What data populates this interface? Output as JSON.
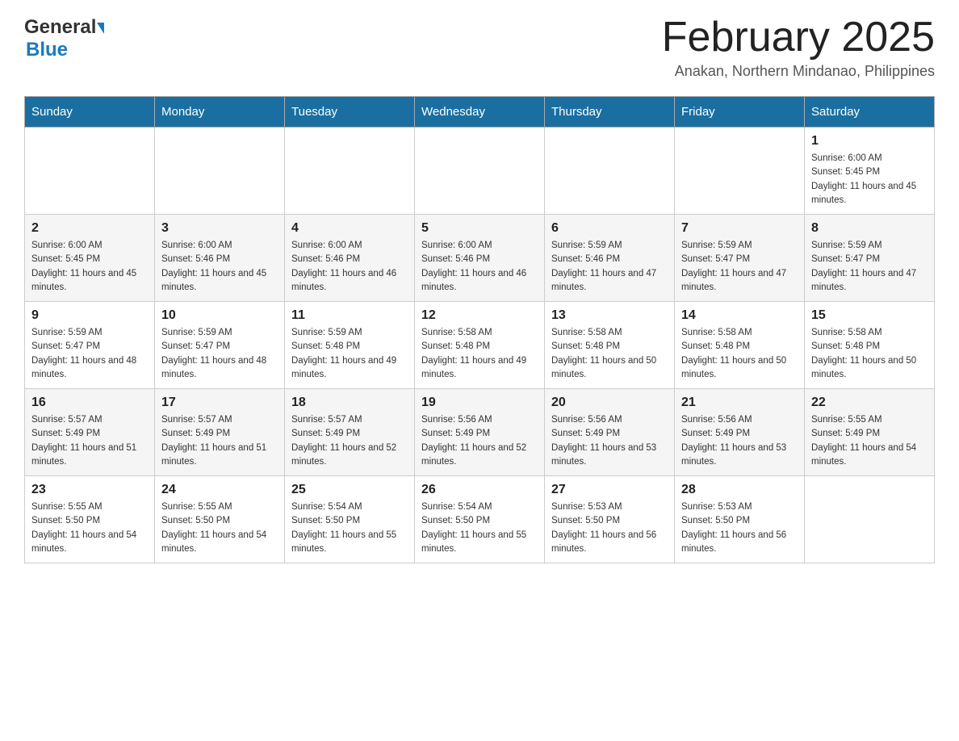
{
  "header": {
    "logo_general": "General",
    "logo_blue": "Blue",
    "month_title": "February 2025",
    "location": "Anakan, Northern Mindanao, Philippines"
  },
  "days_of_week": [
    "Sunday",
    "Monday",
    "Tuesday",
    "Wednesday",
    "Thursday",
    "Friday",
    "Saturday"
  ],
  "weeks": [
    [
      {
        "day": "",
        "info": ""
      },
      {
        "day": "",
        "info": ""
      },
      {
        "day": "",
        "info": ""
      },
      {
        "day": "",
        "info": ""
      },
      {
        "day": "",
        "info": ""
      },
      {
        "day": "",
        "info": ""
      },
      {
        "day": "1",
        "info": "Sunrise: 6:00 AM\nSunset: 5:45 PM\nDaylight: 11 hours and 45 minutes."
      }
    ],
    [
      {
        "day": "2",
        "info": "Sunrise: 6:00 AM\nSunset: 5:45 PM\nDaylight: 11 hours and 45 minutes."
      },
      {
        "day": "3",
        "info": "Sunrise: 6:00 AM\nSunset: 5:46 PM\nDaylight: 11 hours and 45 minutes."
      },
      {
        "day": "4",
        "info": "Sunrise: 6:00 AM\nSunset: 5:46 PM\nDaylight: 11 hours and 46 minutes."
      },
      {
        "day": "5",
        "info": "Sunrise: 6:00 AM\nSunset: 5:46 PM\nDaylight: 11 hours and 46 minutes."
      },
      {
        "day": "6",
        "info": "Sunrise: 5:59 AM\nSunset: 5:46 PM\nDaylight: 11 hours and 47 minutes."
      },
      {
        "day": "7",
        "info": "Sunrise: 5:59 AM\nSunset: 5:47 PM\nDaylight: 11 hours and 47 minutes."
      },
      {
        "day": "8",
        "info": "Sunrise: 5:59 AM\nSunset: 5:47 PM\nDaylight: 11 hours and 47 minutes."
      }
    ],
    [
      {
        "day": "9",
        "info": "Sunrise: 5:59 AM\nSunset: 5:47 PM\nDaylight: 11 hours and 48 minutes."
      },
      {
        "day": "10",
        "info": "Sunrise: 5:59 AM\nSunset: 5:47 PM\nDaylight: 11 hours and 48 minutes."
      },
      {
        "day": "11",
        "info": "Sunrise: 5:59 AM\nSunset: 5:48 PM\nDaylight: 11 hours and 49 minutes."
      },
      {
        "day": "12",
        "info": "Sunrise: 5:58 AM\nSunset: 5:48 PM\nDaylight: 11 hours and 49 minutes."
      },
      {
        "day": "13",
        "info": "Sunrise: 5:58 AM\nSunset: 5:48 PM\nDaylight: 11 hours and 50 minutes."
      },
      {
        "day": "14",
        "info": "Sunrise: 5:58 AM\nSunset: 5:48 PM\nDaylight: 11 hours and 50 minutes."
      },
      {
        "day": "15",
        "info": "Sunrise: 5:58 AM\nSunset: 5:48 PM\nDaylight: 11 hours and 50 minutes."
      }
    ],
    [
      {
        "day": "16",
        "info": "Sunrise: 5:57 AM\nSunset: 5:49 PM\nDaylight: 11 hours and 51 minutes."
      },
      {
        "day": "17",
        "info": "Sunrise: 5:57 AM\nSunset: 5:49 PM\nDaylight: 11 hours and 51 minutes."
      },
      {
        "day": "18",
        "info": "Sunrise: 5:57 AM\nSunset: 5:49 PM\nDaylight: 11 hours and 52 minutes."
      },
      {
        "day": "19",
        "info": "Sunrise: 5:56 AM\nSunset: 5:49 PM\nDaylight: 11 hours and 52 minutes."
      },
      {
        "day": "20",
        "info": "Sunrise: 5:56 AM\nSunset: 5:49 PM\nDaylight: 11 hours and 53 minutes."
      },
      {
        "day": "21",
        "info": "Sunrise: 5:56 AM\nSunset: 5:49 PM\nDaylight: 11 hours and 53 minutes."
      },
      {
        "day": "22",
        "info": "Sunrise: 5:55 AM\nSunset: 5:49 PM\nDaylight: 11 hours and 54 minutes."
      }
    ],
    [
      {
        "day": "23",
        "info": "Sunrise: 5:55 AM\nSunset: 5:50 PM\nDaylight: 11 hours and 54 minutes."
      },
      {
        "day": "24",
        "info": "Sunrise: 5:55 AM\nSunset: 5:50 PM\nDaylight: 11 hours and 54 minutes."
      },
      {
        "day": "25",
        "info": "Sunrise: 5:54 AM\nSunset: 5:50 PM\nDaylight: 11 hours and 55 minutes."
      },
      {
        "day": "26",
        "info": "Sunrise: 5:54 AM\nSunset: 5:50 PM\nDaylight: 11 hours and 55 minutes."
      },
      {
        "day": "27",
        "info": "Sunrise: 5:53 AM\nSunset: 5:50 PM\nDaylight: 11 hours and 56 minutes."
      },
      {
        "day": "28",
        "info": "Sunrise: 5:53 AM\nSunset: 5:50 PM\nDaylight: 11 hours and 56 minutes."
      },
      {
        "day": "",
        "info": ""
      }
    ]
  ]
}
